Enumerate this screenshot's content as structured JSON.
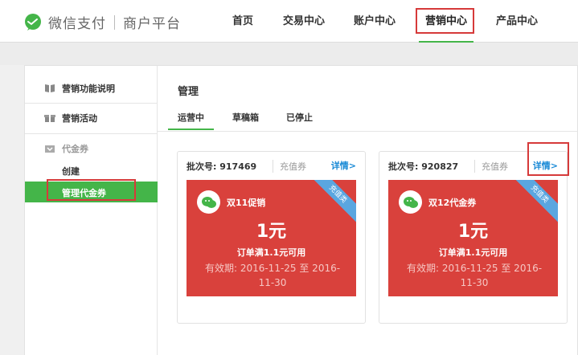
{
  "header": {
    "brand_title": "微信支付",
    "brand_sub": "商户平台",
    "nav": [
      {
        "label": "首页"
      },
      {
        "label": "交易中心"
      },
      {
        "label": "账户中心"
      },
      {
        "label": "营销中心"
      },
      {
        "label": "产品中心"
      }
    ],
    "active_nav": "营销中心"
  },
  "sidebar": {
    "items": [
      {
        "label": "营销功能说明",
        "icon": "book-icon"
      },
      {
        "label": "营销活动",
        "icon": "gift-icon"
      },
      {
        "label": "代金券",
        "icon": "coupon-icon"
      }
    ],
    "sub_items": [
      {
        "label": "创建"
      },
      {
        "label": "管理代金券"
      }
    ],
    "active_sub": "管理代金券"
  },
  "main": {
    "title": "管理",
    "tabs": [
      {
        "label": "运营中"
      },
      {
        "label": "草稿箱"
      },
      {
        "label": "已停止"
      }
    ],
    "active_tab": "运营中",
    "coupons": [
      {
        "batch_label": "批次号:",
        "batch_no": "917469",
        "type": "充值券",
        "detail": "详情>",
        "ribbon": "充值类",
        "name": "双11促销",
        "amount": "1元",
        "condition": "订单满1.1元可用",
        "validity_label": "有效期:",
        "validity": "2016-11-25 至 2016-11-30"
      },
      {
        "batch_label": "批次号:",
        "batch_no": "920827",
        "type": "充值券",
        "detail": "详情>",
        "ribbon": "充值类",
        "name": "双12代金券",
        "amount": "1元",
        "condition": "订单满1.1元可用",
        "validity_label": "有效期:",
        "validity": "2016-11-25 至 2016-11-30"
      }
    ]
  },
  "colors": {
    "brand_green": "#44b549",
    "coupon_red": "#d9413c",
    "ribbon_blue": "#5aa6e0",
    "link_blue": "#1a8ad6",
    "annotation_red": "#d63a3a"
  }
}
